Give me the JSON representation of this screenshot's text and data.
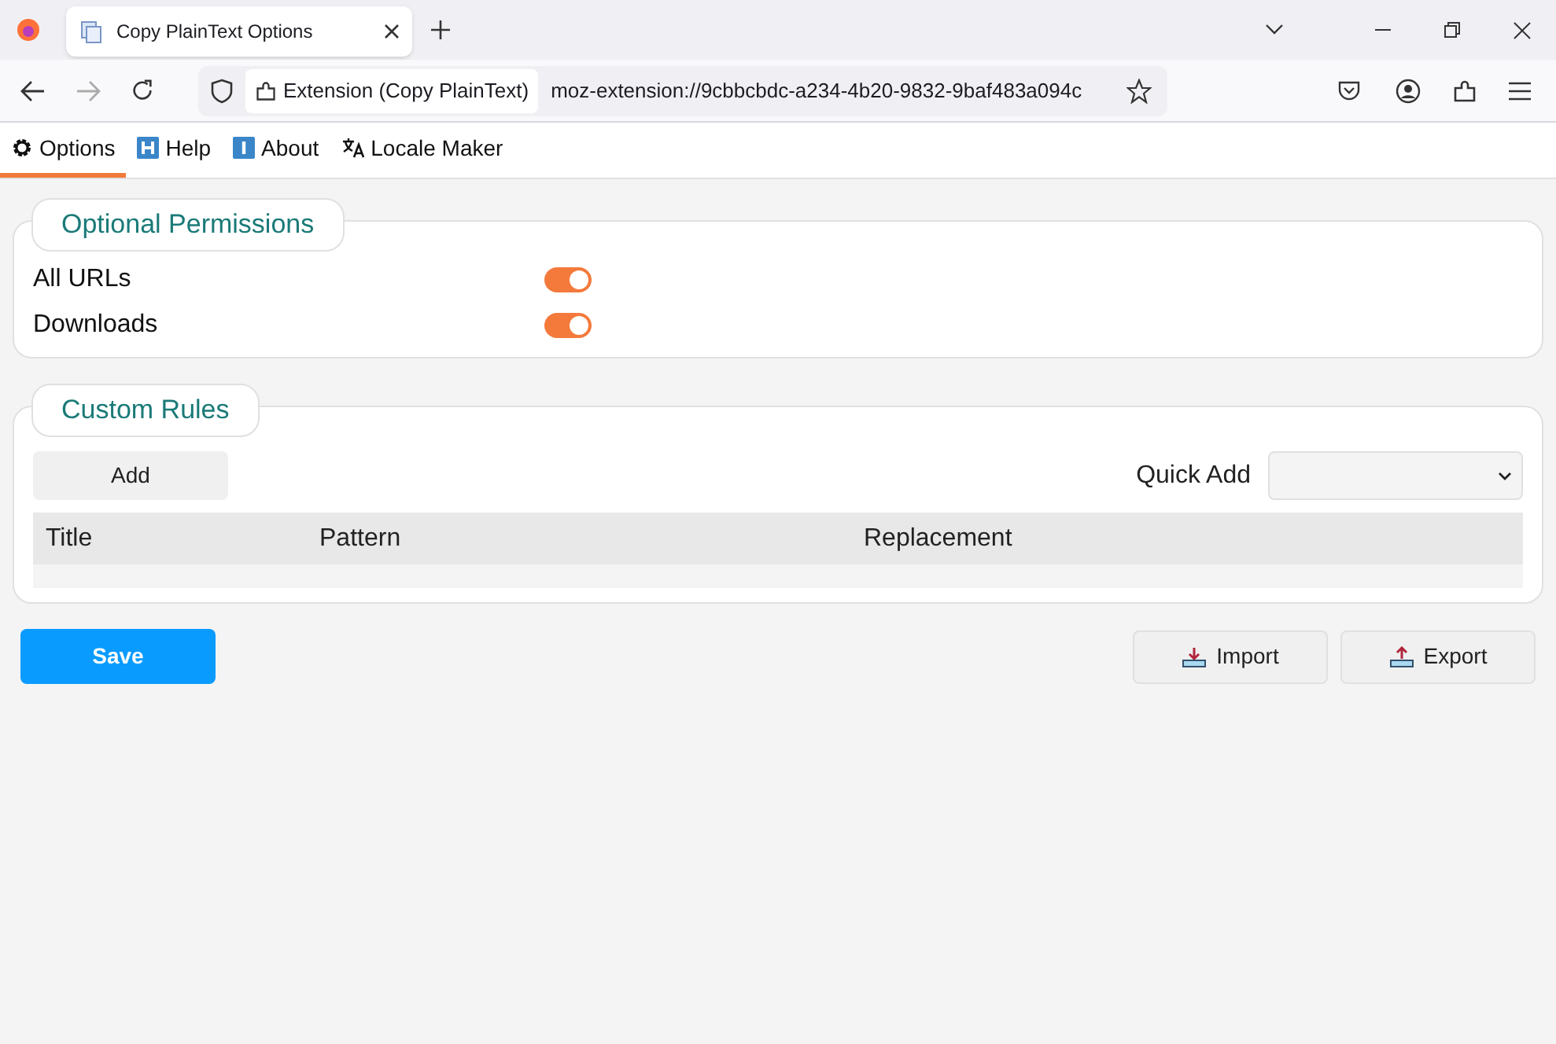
{
  "browser": {
    "tab_title": "Copy PlainText Options",
    "identity_label": "Extension (Copy PlainText)",
    "url": "moz-extension://9cbbcbdc-a234-4b20-9832-9baf483a094c"
  },
  "nav_tabs": [
    {
      "label": "Options",
      "kind": "gear",
      "selected": true
    },
    {
      "label": "Help",
      "kind": "help",
      "selected": false
    },
    {
      "label": "About",
      "kind": "about",
      "selected": false
    },
    {
      "label": "Locale Maker",
      "kind": "translate",
      "selected": false
    }
  ],
  "permissions": {
    "title": "Optional Permissions",
    "items": [
      {
        "label": "All URLs",
        "on": true
      },
      {
        "label": "Downloads",
        "on": true
      }
    ]
  },
  "custom_rules": {
    "title": "Custom Rules",
    "add_button": "Add",
    "quick_add_label": "Quick Add",
    "columns": [
      "Title",
      "Pattern",
      "Replacement"
    ]
  },
  "buttons": {
    "save": "Save",
    "import": "Import",
    "export": "Export"
  }
}
